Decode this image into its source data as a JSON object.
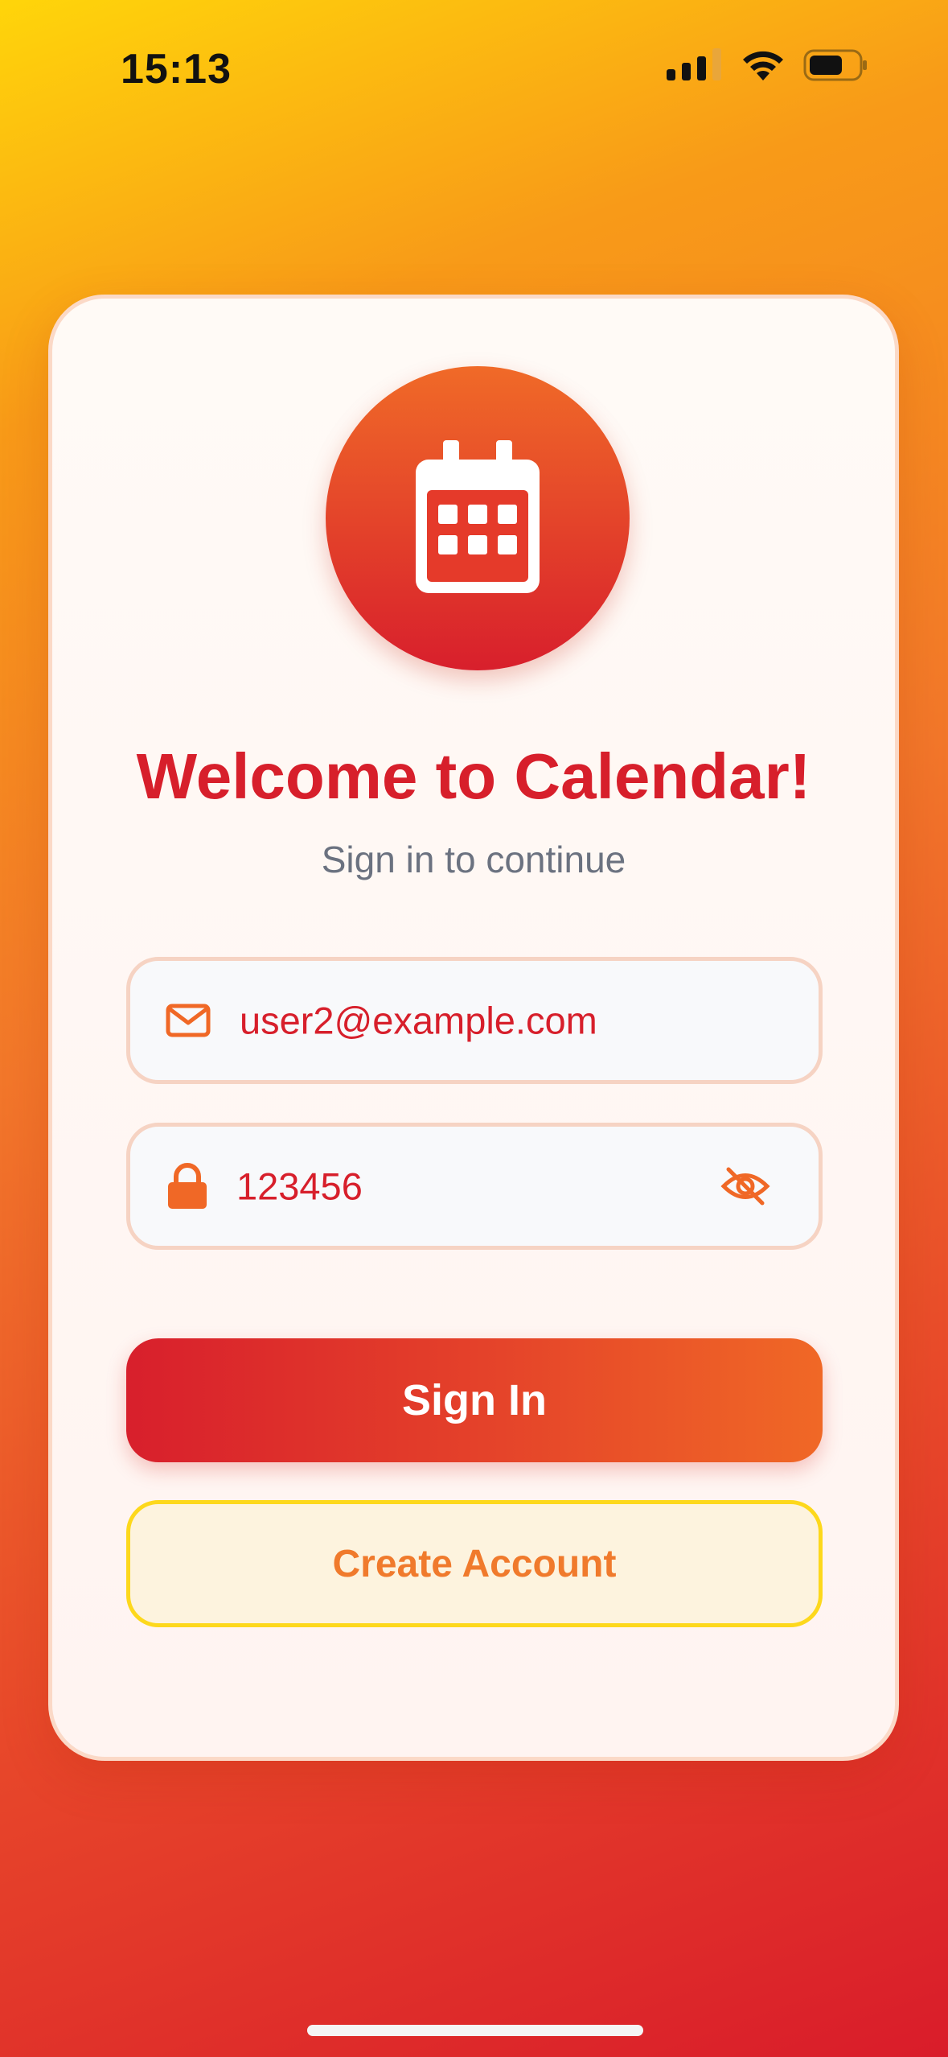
{
  "status_bar": {
    "time": "15:13"
  },
  "logo": {
    "icon": "calendar-icon"
  },
  "welcome": {
    "title": "Welcome to Calendar!",
    "subtitle": "Sign in to continue"
  },
  "email_field": {
    "icon": "envelope-icon",
    "value": "user2@example.com"
  },
  "password_field": {
    "icon": "lock-icon",
    "value": "123456",
    "toggle_icon": "eye-slash-icon"
  },
  "buttons": {
    "sign_in": "Sign In",
    "create_account": "Create Account"
  },
  "colors": {
    "primary_red": "#D71F2B",
    "accent_orange": "#F06826",
    "accent_yellow": "#FDD81C"
  }
}
